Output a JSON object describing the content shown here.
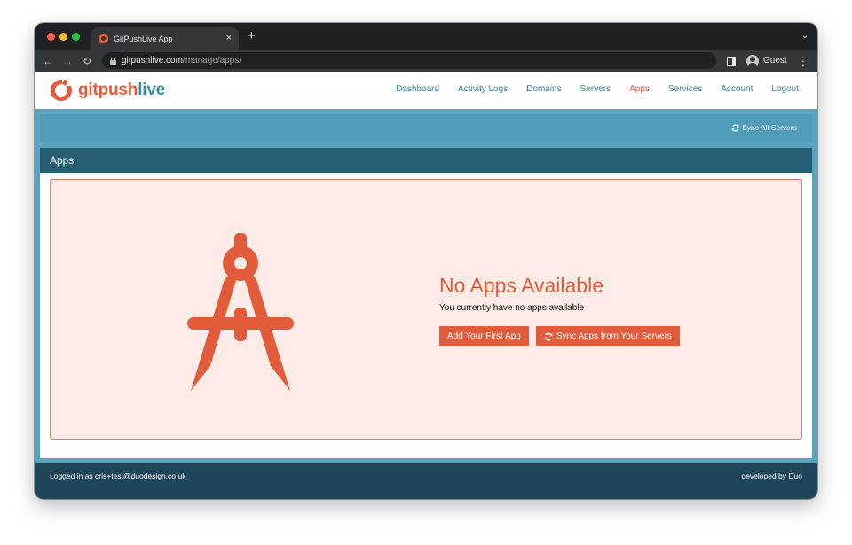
{
  "browser": {
    "tab_title": "GitPushLive App",
    "tab_close": "×",
    "new_tab": "+",
    "url_host": "gitpushlive.com",
    "url_path": "/manage/apps/",
    "profile_label": "Guest"
  },
  "header": {
    "logo": {
      "part1": "git",
      "part2": "push",
      "part3": "live"
    },
    "nav": [
      "Dashboard",
      "Activity Logs",
      "Domains",
      "Servers",
      "Apps",
      "Services",
      "Account",
      "Logout"
    ],
    "active_nav": "Apps"
  },
  "sync_bar": {
    "label": "Sync All Servers"
  },
  "panel": {
    "title": "Apps"
  },
  "empty_state": {
    "icon": "compass-drafting-icon",
    "title": "No Apps Available",
    "subtitle": "You currently have no apps available",
    "primary_button": "Add Your First App",
    "secondary_button": "Sync Apps from Your Servers"
  },
  "footer": {
    "left": "Logged in as cris+test@duodesign.co.uk",
    "right": "developed by Duo"
  },
  "colors": {
    "accent": "#e25c3b",
    "brand_blue": "#3d8ca8",
    "header_bar": "#265e74",
    "footer": "#1e4658",
    "empty_bg": "#fcebe7"
  }
}
